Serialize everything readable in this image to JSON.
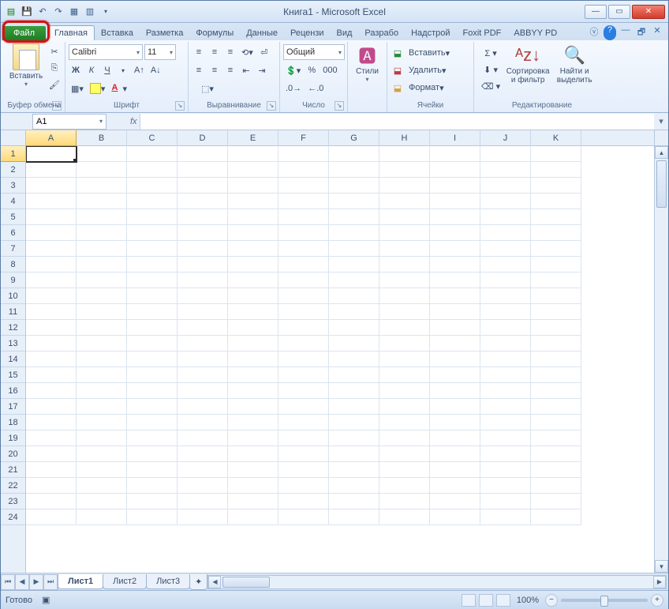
{
  "title": "Книга1  -  Microsoft Excel",
  "qat_icons": [
    "excel",
    "save",
    "undo",
    "redo",
    "qat1",
    "qat2",
    "qat-dd"
  ],
  "tabs": {
    "file": "Файл",
    "list": [
      "Главная",
      "Вставка",
      "Разметка",
      "Формулы",
      "Данные",
      "Рецензи",
      "Вид",
      "Разрабо",
      "Надстрой",
      "Foxit PDF",
      "ABBYY PD"
    ],
    "active": 0
  },
  "help_icons": [
    "ⓘ",
    "?",
    "▭",
    "🗗",
    "✕"
  ],
  "ribbon": {
    "clipboard": {
      "paste": "Вставить",
      "label": "Буфер обмена"
    },
    "font": {
      "name": "Calibri",
      "size": "11",
      "bold": "Ж",
      "italic": "К",
      "underline": "Ч",
      "label": "Шрифт"
    },
    "align": {
      "wrap": "≡▾",
      "merge": "⬚▾",
      "label": "Выравнивание"
    },
    "number": {
      "format": "Общий",
      "label": "Число"
    },
    "styles": {
      "btn": "Стили",
      "label": ""
    },
    "cells": {
      "insert": "Вставить",
      "delete": "Удалить",
      "format": "Формат",
      "label": "Ячейки"
    },
    "editing": {
      "sort": "Сортировка и фильтр",
      "find": "Найти и выделить",
      "label": "Редактирование"
    }
  },
  "namebox": "A1",
  "fx": "fx",
  "columns": [
    "A",
    "B",
    "C",
    "D",
    "E",
    "F",
    "G",
    "H",
    "I",
    "J",
    "K"
  ],
  "row_count": 24,
  "sheet_tabs": [
    "Лист1",
    "Лист2",
    "Лист3"
  ],
  "status": "Готово",
  "zoom": "100%"
}
